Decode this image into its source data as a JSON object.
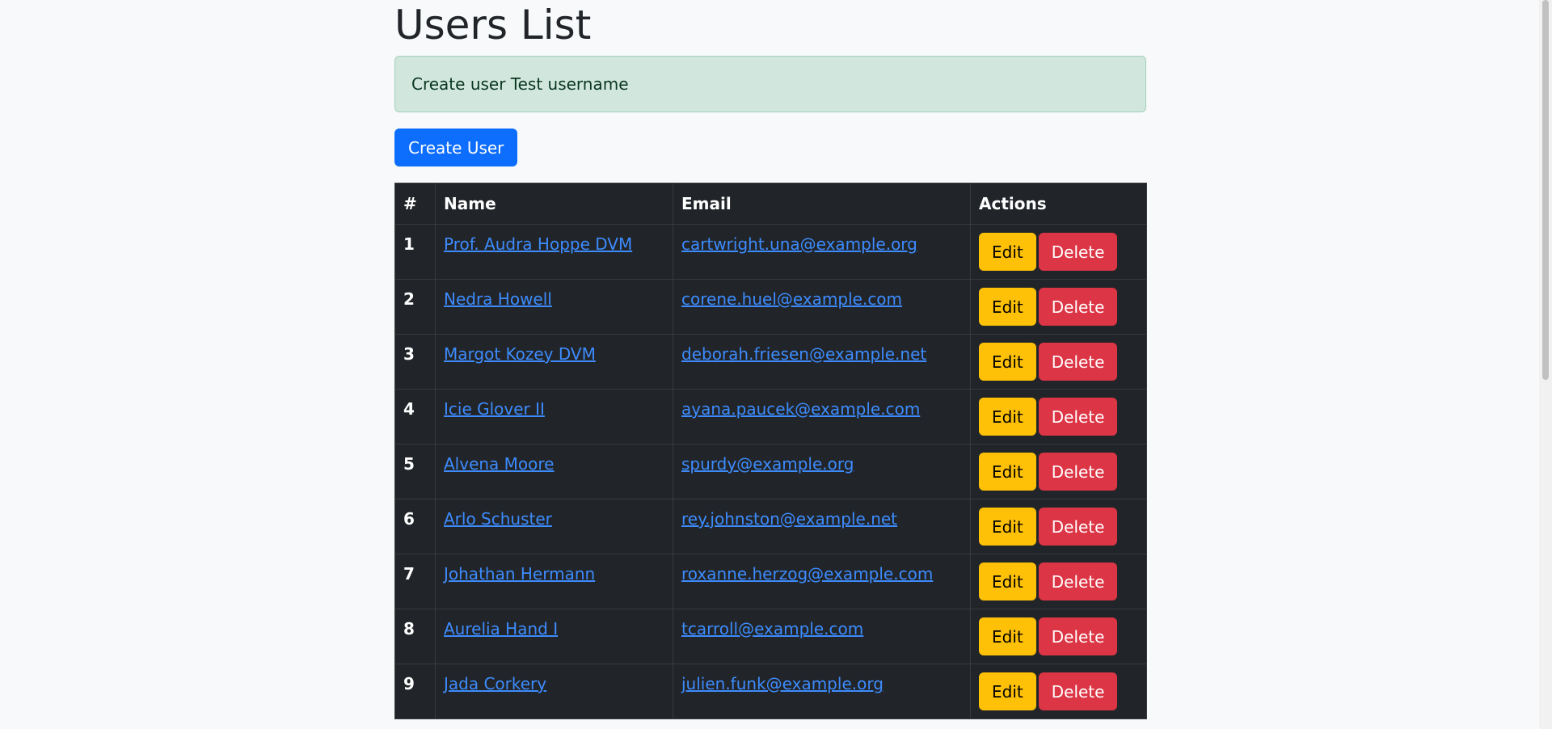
{
  "page": {
    "title": "Users List"
  },
  "alert": {
    "message": "Create user Test username"
  },
  "toolbar": {
    "create_label": "Create User"
  },
  "table": {
    "headers": [
      "#",
      "Name",
      "Email",
      "Actions"
    ],
    "edit_label": "Edit",
    "delete_label": "Delete",
    "rows": [
      {
        "id": "1",
        "name": "Prof. Audra Hoppe DVM",
        "email": "cartwright.una@example.org"
      },
      {
        "id": "2",
        "name": "Nedra Howell",
        "email": "corene.huel@example.com"
      },
      {
        "id": "3",
        "name": "Margot Kozey DVM",
        "email": "deborah.friesen@example.net"
      },
      {
        "id": "4",
        "name": "Icie Glover II",
        "email": "ayana.paucek@example.com"
      },
      {
        "id": "5",
        "name": "Alvena Moore",
        "email": "spurdy@example.org"
      },
      {
        "id": "6",
        "name": "Arlo Schuster",
        "email": "rey.johnston@example.net"
      },
      {
        "id": "7",
        "name": "Johathan Hermann",
        "email": "roxanne.herzog@example.com"
      },
      {
        "id": "8",
        "name": "Aurelia Hand I",
        "email": "tcarroll@example.com"
      },
      {
        "id": "9",
        "name": "Jada Corkery",
        "email": "julien.funk@example.org"
      }
    ]
  },
  "colors": {
    "primary": "#0d6efd",
    "warning": "#ffc107",
    "danger": "#dc3545",
    "success_bg": "#d1e7dd",
    "table_bg": "#212529",
    "link": "#3d8bfd"
  }
}
